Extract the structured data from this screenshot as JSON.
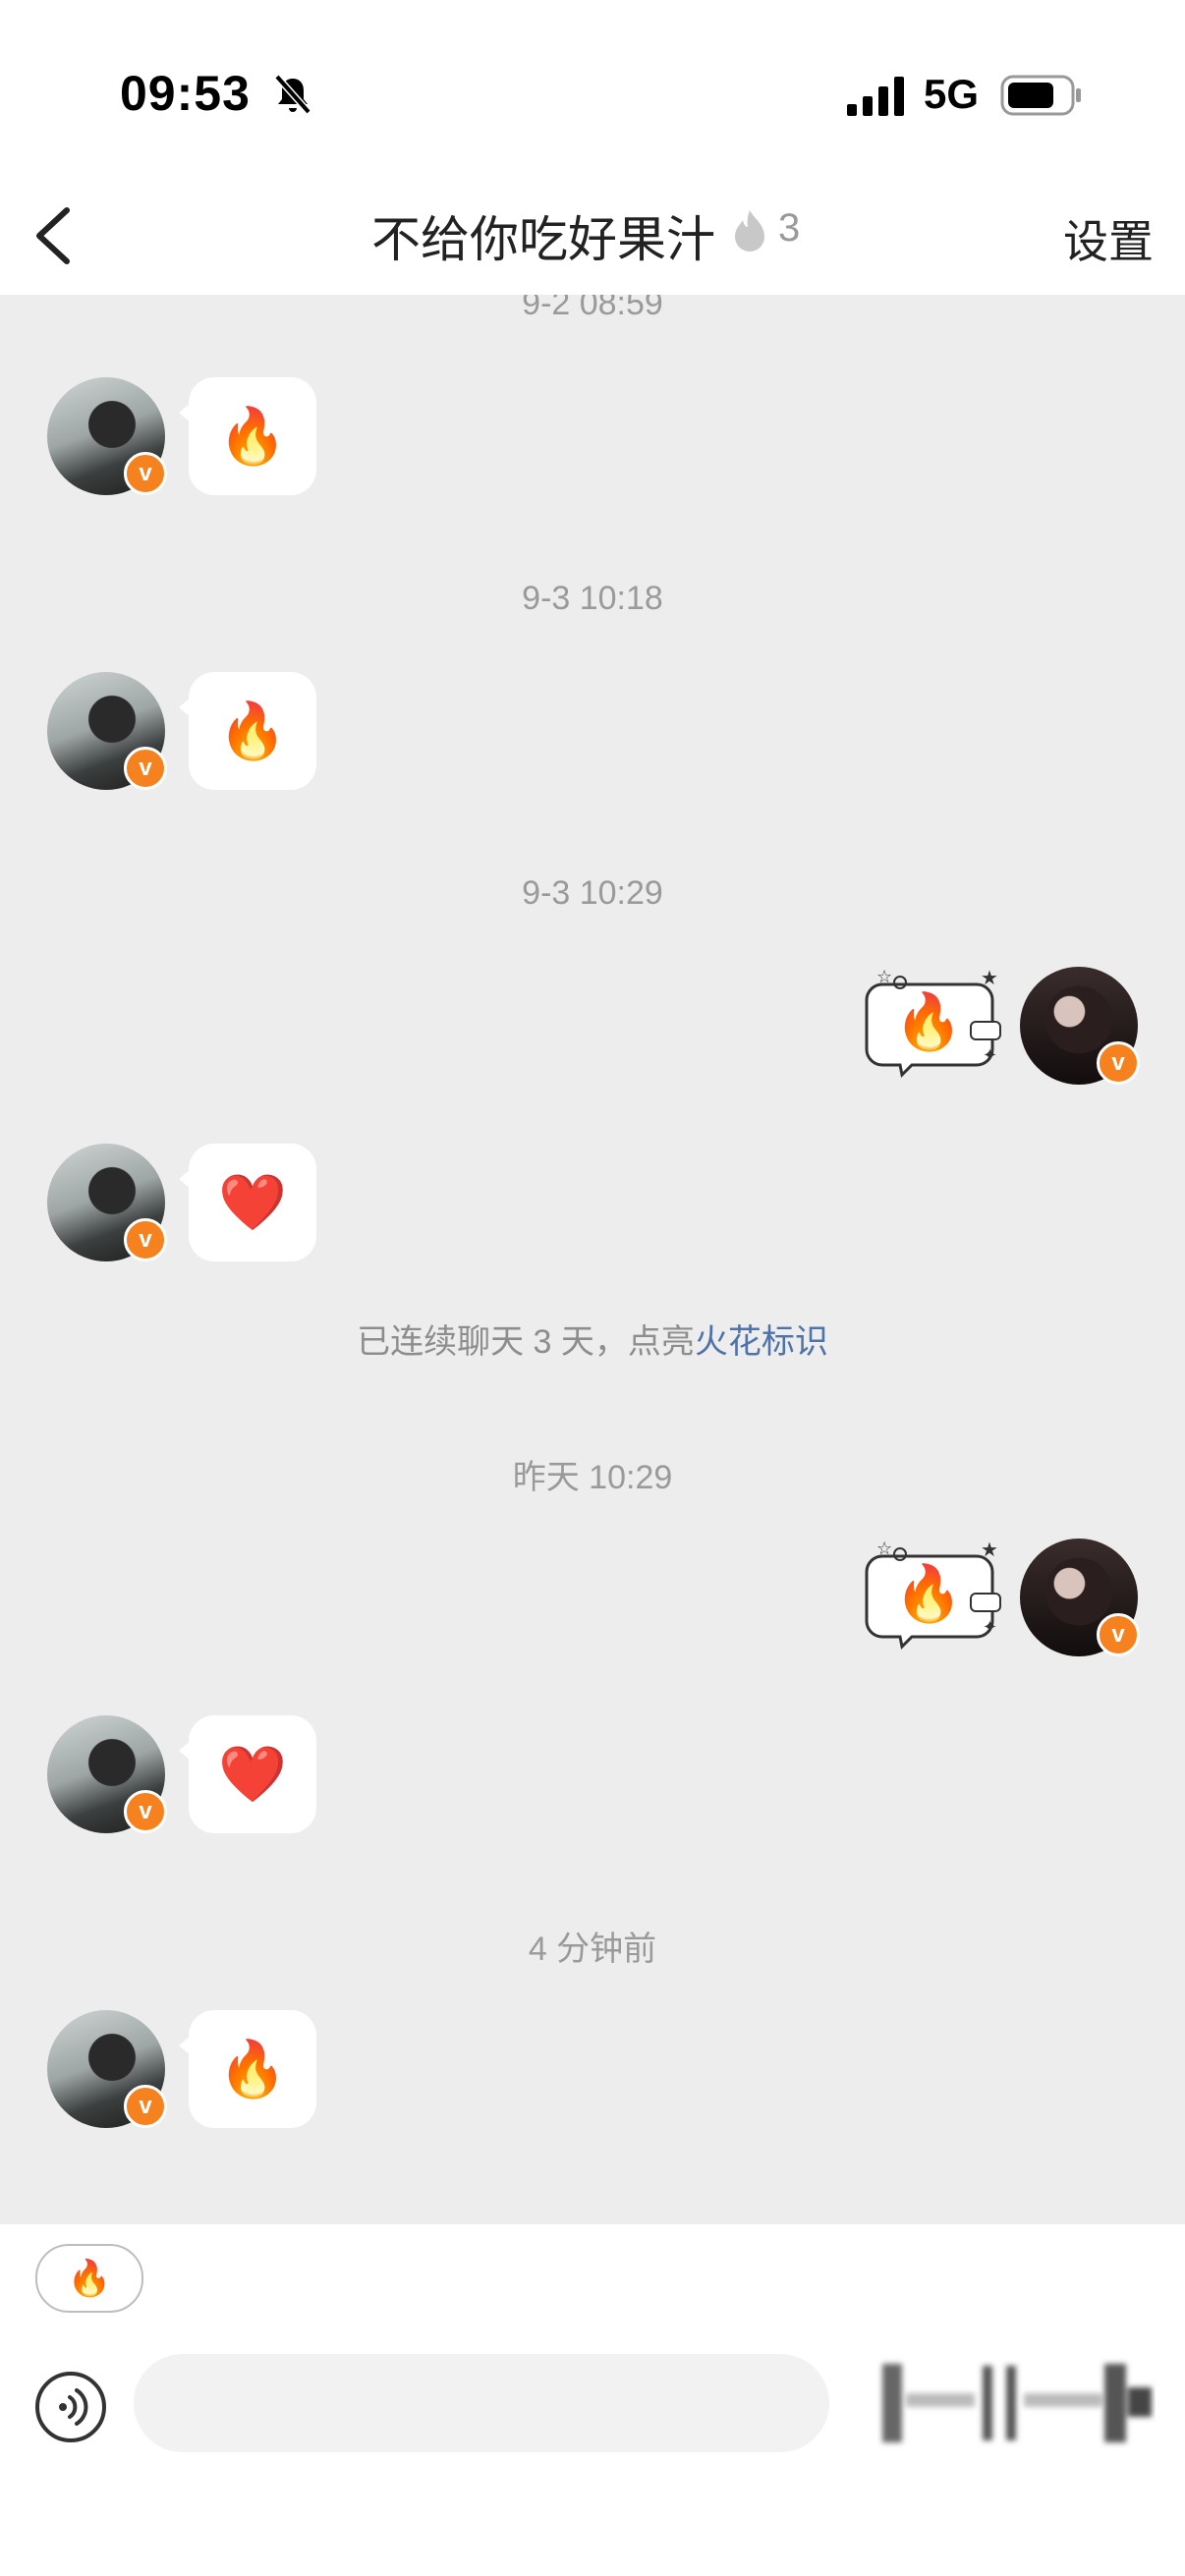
{
  "status_bar": {
    "time": "09:53",
    "network": "5G"
  },
  "header": {
    "title": "不给你吃好果汁",
    "flame_count": "3",
    "settings_label": "设置"
  },
  "messages": {
    "ts1": "9-2 08:59",
    "m1": "🔥",
    "ts2": "9-3 10:18",
    "m2": "🔥",
    "ts3": "9-3 10:29",
    "m3": "🔥",
    "m4": "❤️",
    "notice_text": "已连续聊天 3 天，点亮",
    "notice_link": "火花标识",
    "ts4": "昨天 10:29",
    "m5": "🔥",
    "m6": "❤️",
    "ts5": "4 分钟前",
    "m7": "🔥"
  },
  "input": {
    "quick_reply": "🔥",
    "placeholder": ""
  },
  "colors": {
    "accent_badge": "#f5821f",
    "link": "#4f72a8",
    "chat_bg": "#ededed"
  }
}
